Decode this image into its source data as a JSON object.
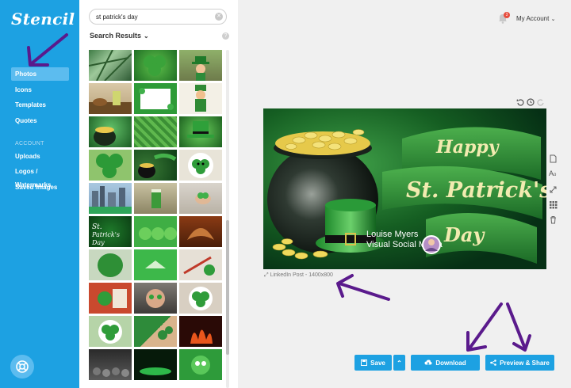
{
  "app": {
    "logo": "Stencil"
  },
  "sidebar": {
    "items": [
      {
        "label": "Photos",
        "active": true
      },
      {
        "label": "Icons"
      },
      {
        "label": "Templates"
      },
      {
        "label": "Quotes"
      }
    ],
    "account_section": "ACCOUNT",
    "account_items": [
      {
        "label": "Uploads"
      },
      {
        "label": "Logos / Watermarks"
      },
      {
        "label": "Saved Images"
      }
    ],
    "help_icon": "lifebuoy-icon"
  },
  "search": {
    "value": "st patrick's day",
    "results_label": "Search Results"
  },
  "thumbnails": [
    [
      "palm",
      "clover",
      "leprechaun"
    ],
    [
      "cupcake",
      "frame",
      "figure"
    ],
    [
      "pot",
      "clover-field",
      "hat"
    ],
    [
      "shamrock",
      "pot",
      "cookie"
    ],
    [
      "river",
      "beer",
      "clover-hand"
    ],
    [
      "stpatricks-day",
      "cupcakes",
      "pretzel"
    ],
    [
      "clover-hand",
      "paper-boat",
      "scissors"
    ],
    [
      "craft",
      "face-paint",
      "cookie"
    ],
    [
      "cookie",
      "paper-cutouts",
      "fire"
    ],
    [
      "crowd",
      "night",
      "clover-eyes"
    ]
  ],
  "header": {
    "account_label": "My Account",
    "notification_count": "3"
  },
  "canvas": {
    "banner_line1": "Happy",
    "banner_line2": "St. Patrick's",
    "banner_line3": "Day",
    "author_name": "Louise Myers",
    "author_sub": "Visual Social Media",
    "size_label": "LinkedIn Post - 1400x800"
  },
  "actions": {
    "save": "Save",
    "download": "Download",
    "preview_share": "Preview & Share"
  },
  "colors": {
    "brand": "#1da1e2",
    "annotation": "#5a1a8c"
  }
}
